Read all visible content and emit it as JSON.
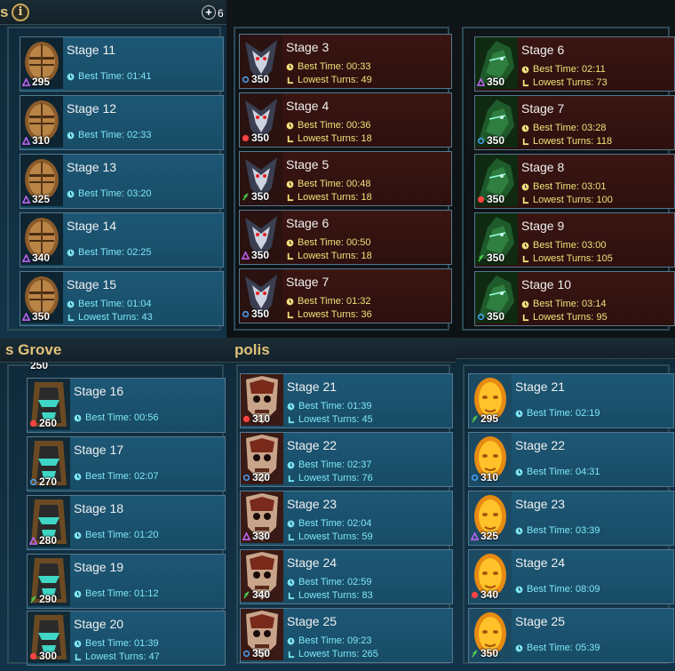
{
  "top_left": {
    "partial_title": "s",
    "info_icon": "info-icon",
    "add_icon": "plus-icon",
    "counter": "6"
  },
  "headers": {
    "bottom_left": "s Grove",
    "bottom_mid": "polis"
  },
  "panels": [
    {
      "theme": "blue",
      "portrait": "gold-knight",
      "cards": [
        {
          "stage": "Stage 11",
          "power": "295",
          "affinity": "void",
          "best": "Best Time: 01:41"
        },
        {
          "stage": "Stage 12",
          "power": "310",
          "affinity": "void",
          "best": "Best Time: 02:33"
        },
        {
          "stage": "Stage 13",
          "power": "325",
          "affinity": "void",
          "best": "Best Time: 03:20"
        },
        {
          "stage": "Stage 14",
          "power": "340",
          "affinity": "void",
          "best": "Best Time: 02:25"
        },
        {
          "stage": "Stage 15",
          "power": "350",
          "affinity": "void",
          "best": "Best Time: 01:04",
          "turns": "Lowest Turns: 43"
        }
      ]
    },
    {
      "theme": "red",
      "portrait": "dark-reaper",
      "cards": [
        {
          "stage": "Stage 3",
          "power": "350",
          "affinity": "magic",
          "best": "Best Time: 00:33",
          "turns": "Lowest Turns: 49"
        },
        {
          "stage": "Stage 4",
          "power": "350",
          "affinity": "force",
          "best": "Best Time: 00:36",
          "turns": "Lowest Turns: 18"
        },
        {
          "stage": "Stage 5",
          "power": "350",
          "affinity": "spirit",
          "best": "Best Time: 00:48",
          "turns": "Lowest Turns: 18"
        },
        {
          "stage": "Stage 6",
          "power": "350",
          "affinity": "void",
          "best": "Best Time: 00:50",
          "turns": "Lowest Turns: 18"
        },
        {
          "stage": "Stage 7",
          "power": "350",
          "affinity": "magic",
          "best": "Best Time: 01:32",
          "turns": "Lowest Turns: 36"
        }
      ]
    },
    {
      "theme": "red",
      "portrait": "green-dragon",
      "cards": [
        {
          "stage": "Stage 6",
          "power": "350",
          "affinity": "void",
          "best": "Best Time: 02:11",
          "turns": "Lowest Turns: 73"
        },
        {
          "stage": "Stage 7",
          "power": "350",
          "affinity": "magic",
          "best": "Best Time: 03:28",
          "turns": "Lowest Turns: 118"
        },
        {
          "stage": "Stage 8",
          "power": "350",
          "affinity": "force",
          "best": "Best Time: 03:01",
          "turns": "Lowest Turns: 100"
        },
        {
          "stage": "Stage 9",
          "power": "350",
          "affinity": "spirit",
          "best": "Best Time: 03:00",
          "turns": "Lowest Turns: 105"
        },
        {
          "stage": "Stage 10",
          "power": "350",
          "affinity": "magic",
          "best": "Best Time: 03:14",
          "turns": "Lowest Turns: 95"
        }
      ]
    },
    {
      "theme": "blue",
      "portrait": "teal-pharaoh",
      "above_power": "250",
      "cards": [
        {
          "stage": "Stage 16",
          "power": "260",
          "affinity": "force",
          "best": "Best Time: 00:56"
        },
        {
          "stage": "Stage 17",
          "power": "270",
          "affinity": "magic",
          "best": "Best Time: 02:07"
        },
        {
          "stage": "Stage 18",
          "power": "280",
          "affinity": "void",
          "best": "Best Time: 01:20"
        },
        {
          "stage": "Stage 19",
          "power": "290",
          "affinity": "spirit",
          "best": "Best Time: 01:12"
        },
        {
          "stage": "Stage 20",
          "power": "300",
          "affinity": "force",
          "best": "Best Time: 01:39",
          "turns": "Lowest Turns: 47"
        }
      ]
    },
    {
      "theme": "blue",
      "portrait": "skull-lich",
      "cards": [
        {
          "stage": "Stage 21",
          "power": "310",
          "affinity": "force",
          "best": "Best Time: 01:39",
          "turns": "Lowest Turns: 45"
        },
        {
          "stage": "Stage 22",
          "power": "320",
          "affinity": "magic",
          "best": "Best Time: 02:37",
          "turns": "Lowest Turns: 76"
        },
        {
          "stage": "Stage 23",
          "power": "330",
          "affinity": "void",
          "best": "Best Time: 02:04",
          "turns": "Lowest Turns: 59"
        },
        {
          "stage": "Stage 24",
          "power": "340",
          "affinity": "spirit",
          "best": "Best Time: 02:59",
          "turns": "Lowest Turns: 83"
        },
        {
          "stage": "Stage 25",
          "power": "350",
          "affinity": "magic",
          "best": "Best Time: 09:23",
          "turns": "Lowest Turns: 265"
        }
      ]
    },
    {
      "theme": "blue",
      "portrait": "golden-mask",
      "cards": [
        {
          "stage": "Stage 21",
          "power": "295",
          "affinity": "spirit",
          "best": "Best Time: 02:19"
        },
        {
          "stage": "Stage 22",
          "power": "310",
          "affinity": "magic",
          "best": "Best Time: 04:31"
        },
        {
          "stage": "Stage 23",
          "power": "325",
          "affinity": "void",
          "best": "Best Time: 03:39"
        },
        {
          "stage": "Stage 24",
          "power": "340",
          "affinity": "force",
          "best": "Best Time: 08:09"
        },
        {
          "stage": "Stage 25",
          "power": "350",
          "affinity": "spirit",
          "best": "Best Time: 05:39"
        }
      ]
    }
  ],
  "colors": {
    "void": "#c765ff",
    "magic": "#49a6ff",
    "force": "#ff4242",
    "spirit": "#4fd34f",
    "cyan_text": "#7ee6f5",
    "yellow_text": "#f3e07a"
  }
}
